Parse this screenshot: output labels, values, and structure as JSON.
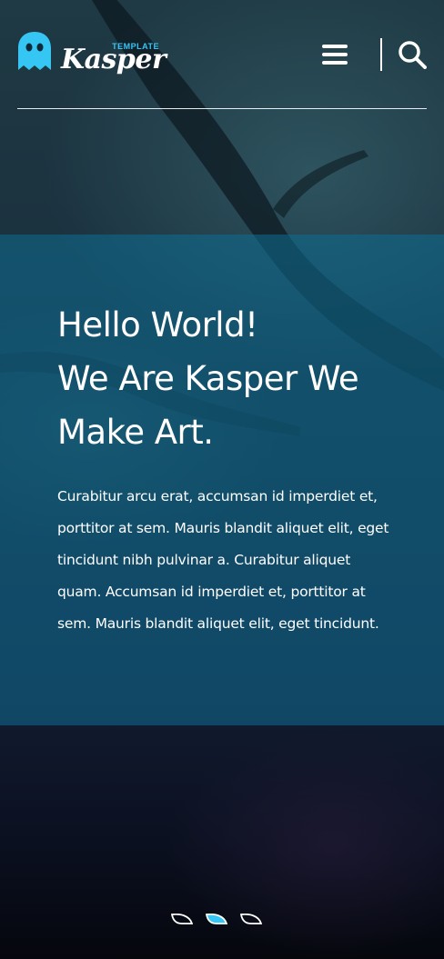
{
  "brand": {
    "name": "Kasper",
    "tagline": "TEMPLATE",
    "accent": "#36c6f4"
  },
  "header": {
    "menu_icon": "hamburger-menu-icon",
    "search_icon": "search-icon"
  },
  "hero": {
    "headline_lines": [
      "Hello World!",
      "We Are Kasper We",
      "Make Art."
    ],
    "body": "Curabitur arcu erat, accumsan id imperdiet et, porttitor at sem. Mauris blandit aliquet elit, eget tincidunt nibh pulvinar a. Curabitur aliquet quam. Accumsan id imperdiet et, porttitor at sem. Mauris blandit aliquet elit, eget tincidunt.",
    "panel_color": "#0f6e91"
  },
  "slider": {
    "bullet_count": 3,
    "active_index": 1,
    "active_color": "#36c6f4"
  }
}
